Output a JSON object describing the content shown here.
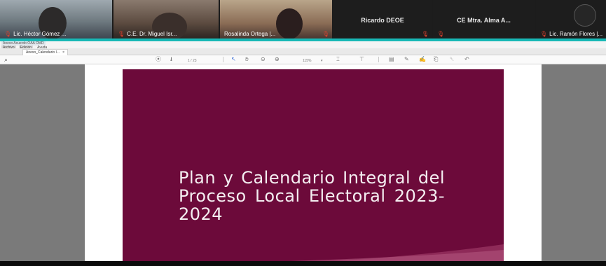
{
  "participants": [
    {
      "name": "Lic. Héctor Gómez ...",
      "muted": true,
      "video": true
    },
    {
      "name": "C.E. Dr. Miguel Isr...",
      "muted": true,
      "video": true
    },
    {
      "name": "Rosalinda Ortega |...",
      "muted": false,
      "video": true
    },
    {
      "name": "Ricardo DEOE",
      "muted": true,
      "video": false
    },
    {
      "name": "CE Mtra. Alma A...",
      "muted": true,
      "video": false
    },
    {
      "name": "Lic. Ramón Flores |...",
      "muted": true,
      "video": false
    }
  ],
  "app": {
    "info_text": "Anexo Acuerdo OAA OMD",
    "menu": [
      "Archivo",
      "Edición",
      "Ayuda"
    ],
    "tab_label": "Anexo_Calendario I...",
    "tab_close": "×"
  },
  "toolbar": {
    "page_indicator": "1 / 23",
    "zoom": "115%"
  },
  "document": {
    "title": "Plan y Calendario Integral del Proceso Local Electoral 2023-2024"
  },
  "colors": {
    "accent_teal": "#18b8b6",
    "cover_maroon": "#6c0a3a",
    "mute_red": "#e0402d"
  }
}
